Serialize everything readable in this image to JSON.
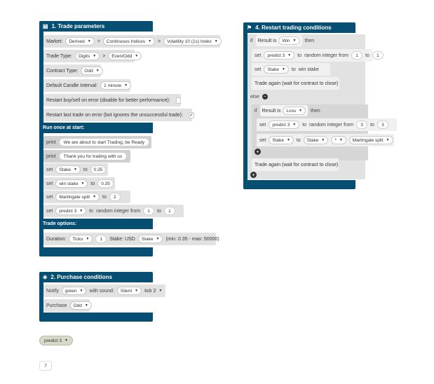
{
  "trade_params": {
    "title": "1. Trade parameters",
    "market_label": "Market:",
    "market": "Derived",
    "submarket": "Continuous Indices",
    "symbol": "Volatility 10 (1s) Index",
    "arrow": ">",
    "trade_type_label": "Trade Type:",
    "trade_type": "Digits",
    "trade_subtype": "Even/Odd",
    "contract_type_label": "Contract Type:",
    "contract_type": "Odd",
    "candle_label": "Default Candle Interval:",
    "candle": "1 minute",
    "restart_error_label": "Restart buy/sell on error (disable for better performance):",
    "restart_last_label": "Restart last trade on error (bot ignores the unsuccessful trade):",
    "restart_last_check": "✓",
    "run_once_title": "Run once at start:",
    "print1_kw": "print",
    "print1": "We are about to start Trading, be Ready",
    "print2_kw": "print",
    "print2": "Thank you for trading with us",
    "set_kw": "set",
    "to_kw": "to",
    "set1_var": "Stake",
    "set1_val": "0.35",
    "set2_var": "win stake",
    "set2_val": "0.35",
    "set3_var": "Martingale split",
    "set3_val": "2",
    "set4_var": "predict 3",
    "random_label": "random integer from",
    "set4_from": "1",
    "set4_to": "1",
    "trade_options_title": "Trade options:",
    "duration_label": "Duration:",
    "duration_unit": "Ticks",
    "duration_val": "1",
    "stake_label": "Stake: USD",
    "stake_var": "Stake",
    "stake_range": "(min: 0.35 - max: 50000)"
  },
  "purchase": {
    "title": "2. Purchase conditions",
    "notify_label": "Notify",
    "notify_color": "green",
    "with_sound_label": "with sound:",
    "sound": "Silent",
    "tick_sound": "tick 2",
    "purchase_label": "Purchase",
    "purchase_type": "Odd"
  },
  "restart": {
    "title": "4. Restart trading conditions",
    "if_kw": "if",
    "result_label": "Result is",
    "result1": "Win",
    "then_kw": "then",
    "set_kw": "set",
    "to_kw": "to",
    "random_label": "random integer from",
    "r_var1": "predict 3",
    "r_from1": "1",
    "r_to1": "1",
    "set_stake_var": "Stake",
    "set_stake_to": "win stake",
    "trade_again": "Trade again (wait for contract to close)",
    "else_kw": "else",
    "result2": "Loss",
    "r_var2": "predict 3",
    "r_from2": "3",
    "r_to2": "3",
    "stake_var2": "Stake",
    "stake_ref": "Stake",
    "operator": "*",
    "martingale": "Martingale split",
    "trade_again2": "Trade again (wait for contract to close)"
  },
  "loose_var": "predict 3",
  "badge": "7"
}
